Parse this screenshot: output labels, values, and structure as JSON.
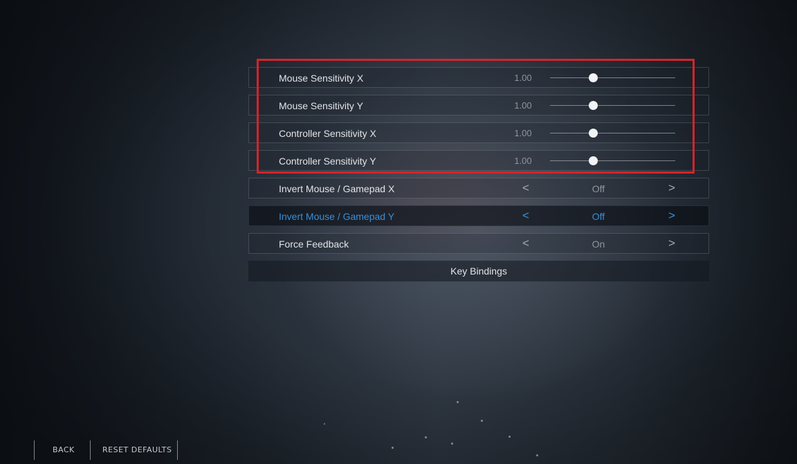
{
  "settings": {
    "rows": [
      {
        "label": "Mouse Sensitivity X",
        "value": "1.00",
        "slider_fraction": 0.34
      },
      {
        "label": "Mouse Sensitivity Y",
        "value": "1.00",
        "slider_fraction": 0.34
      },
      {
        "label": "Controller Sensitivity X",
        "value": "1.00",
        "slider_fraction": 0.34
      },
      {
        "label": "Controller Sensitivity Y",
        "value": "1.00",
        "slider_fraction": 0.34
      }
    ],
    "options": [
      {
        "label": "Invert Mouse / Gamepad X",
        "value": "Off",
        "left_arrow": "<",
        "right_arrow": ">"
      },
      {
        "label": "Invert Mouse / Gamepad Y",
        "value": "Off",
        "left_arrow": "<",
        "right_arrow": ">",
        "selected": true
      },
      {
        "label": "Force Feedback",
        "value": "On",
        "left_arrow": "<",
        "right_arrow": ">"
      }
    ],
    "key_bindings_label": "Key Bindings"
  },
  "footer": {
    "back_label": "BACK",
    "reset_label": "RESET DEFAULTS"
  },
  "colors": {
    "accent": "#3a8fd8",
    "annotation": "#d4242b"
  }
}
